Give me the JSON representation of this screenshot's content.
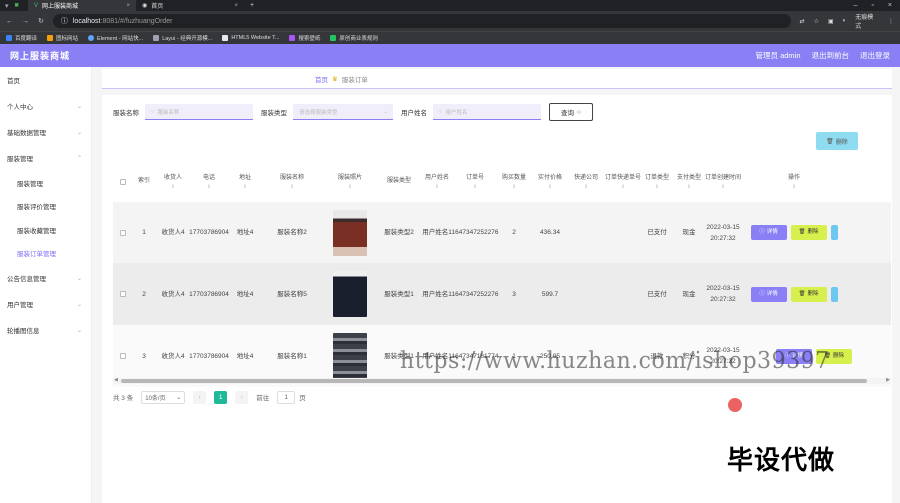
{
  "browser": {
    "tabs": [
      "网上服装商城",
      "首页"
    ],
    "url_host": "localhost",
    "url_rest": ":8081/#/fuzhuangOrder",
    "incognito": "无痕模式",
    "bookmarks": [
      "百度翻译",
      "图标网站",
      "Element - 网站快...",
      "Layui - 经典开源模...",
      "HTML5 Website T...",
      "搜索壁纸",
      "原创商业表规则"
    ]
  },
  "header": {
    "brand": "网上服装商城",
    "admin": "管理员 admin",
    "back": "退出到前台",
    "logout": "退出登录"
  },
  "sidebar": {
    "home": "首页",
    "personal": "个人中心",
    "basic": "基础数据管理",
    "clothes": "服装管理",
    "subs": [
      "服装管理",
      "服装评价管理",
      "服装收藏管理",
      "服装订单管理"
    ],
    "notice": "公告信息管理",
    "user": "用户管理",
    "carousel": "轮播图信息"
  },
  "breadcrumb": {
    "home": "首页",
    "current": "服装订单"
  },
  "filters": {
    "name_label": "服装名称",
    "name_ph": "服装名称",
    "type_label": "服装类型",
    "type_ph": "请选择服装类型",
    "user_label": "用户姓名",
    "user_ph": "用户姓名",
    "query": "查询"
  },
  "delete_label": "删除",
  "columns": [
    "索引",
    "收货人",
    "电话",
    "地址",
    "服装名称",
    "服装照片",
    "服装类型",
    "用户姓名",
    "订单号",
    "购买数量",
    "实付价格",
    "快递公司",
    "订单快递单号",
    "订单类型",
    "支付类型",
    "订单创建时间",
    "操作"
  ],
  "rows": [
    {
      "idx": "1",
      "receiver": "收货人4",
      "phone": "17703786904",
      "addr": "地址4",
      "name": "服装名称2",
      "ctype": "服装类型2",
      "uname": "用户姓名1",
      "order": "1647347252276",
      "qty": "2",
      "price": "436.34",
      "express": "",
      "expno": "",
      "otype": "已支付",
      "pay": "现金",
      "time": "2022-03-15 20:27:32",
      "photo": "dress"
    },
    {
      "idx": "2",
      "receiver": "收货人4",
      "phone": "17703786904",
      "addr": "地址4",
      "name": "服装名称5",
      "ctype": "服装类型1",
      "uname": "用户姓名1",
      "order": "1647347252276",
      "qty": "3",
      "price": "599.7",
      "express": "",
      "expno": "",
      "otype": "已支付",
      "pay": "现金",
      "time": "2022-03-15 20:27:32",
      "photo": "shirt"
    },
    {
      "idx": "3",
      "receiver": "收货人4",
      "phone": "17703786904",
      "addr": "地址4",
      "name": "服装名称1",
      "ctype": "服装类型1",
      "uname": "用户姓名1",
      "order": "1647347181774",
      "qty": "1",
      "price": "250.05",
      "express": "",
      "expno": "",
      "otype": "退款",
      "pay": "积分",
      "time": "2022-03-15 20:27:32",
      "photo": "sweater"
    }
  ],
  "actions": {
    "detail": "详情",
    "delete": "删除"
  },
  "pagination": {
    "total": "共 3 条",
    "size": "10条/页",
    "page": "1",
    "goto": "前往",
    "goto_val": "1",
    "page_unit": "页"
  },
  "overlay": {
    "watermark": "https://www.huzhan.com/ishop39397",
    "big": "毕设代做"
  }
}
